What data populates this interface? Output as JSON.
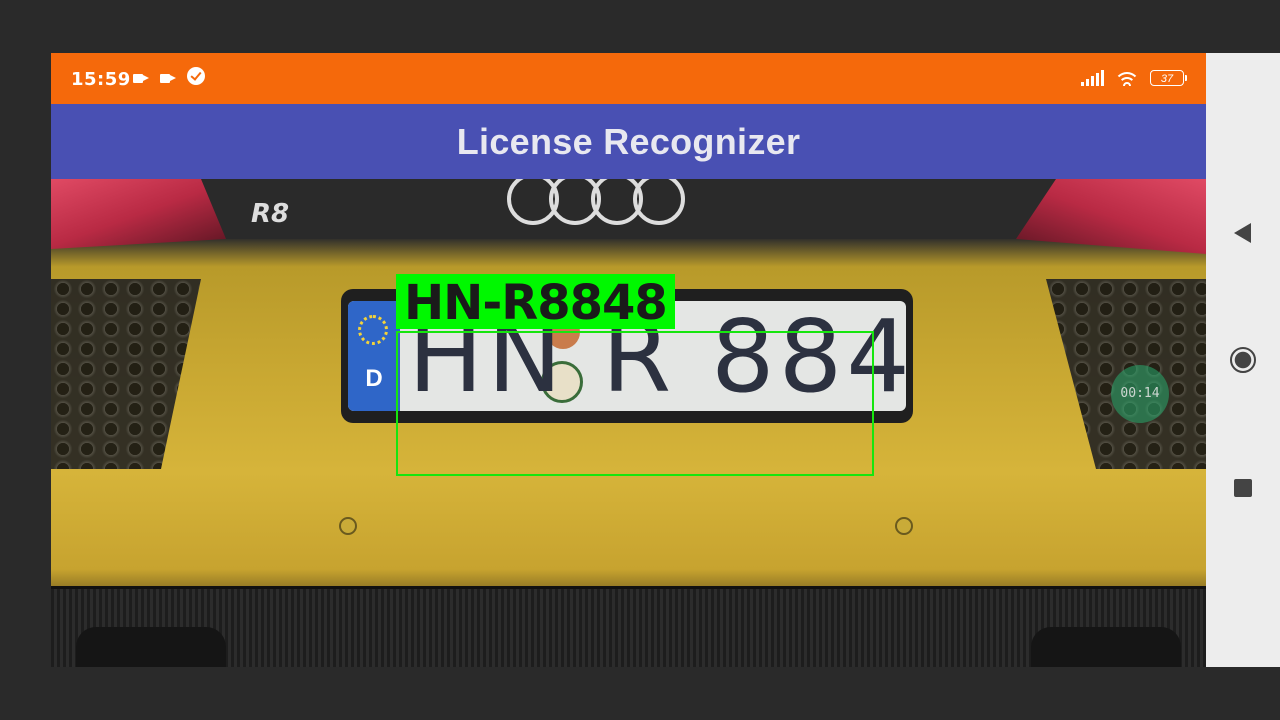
{
  "status_bar": {
    "time": "15:59",
    "left_icons": [
      "video-camera-icon",
      "video-camera-icon",
      "check-circle-icon"
    ],
    "right_icons": [
      "signal-icon",
      "wifi-icon"
    ],
    "battery": "37"
  },
  "app_bar": {
    "title": "License Recognizer"
  },
  "camera_view": {
    "detection": {
      "label": "HN-R8848"
    },
    "plate": {
      "country_code": "D",
      "text": "HN R 8848"
    },
    "recording_timer": "00:14",
    "badge": "R8"
  },
  "nav_bar": {
    "buttons": [
      "back-icon",
      "home-icon",
      "recents-icon"
    ]
  },
  "colors": {
    "status_bar": "#f5690b",
    "app_bar": "#4950b3",
    "detection_box": "#16e60e",
    "detection_label_bg": "#00f800"
  }
}
